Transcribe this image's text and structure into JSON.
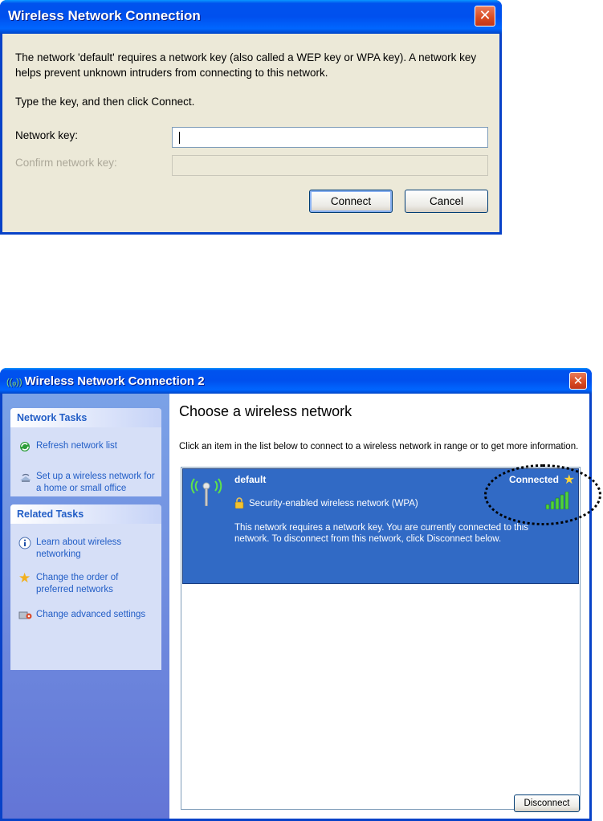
{
  "dialog": {
    "title": "Wireless Network Connection",
    "close_glyph": "✕",
    "message": "The network 'default' requires a network key (also called a WEP key or WPA key). A network key helps prevent unknown intruders from connecting to this network.",
    "prompt": "Type the key, and then click Connect.",
    "network_key_label": "Network key:",
    "confirm_key_label": "Confirm network key:",
    "network_key_value": "",
    "confirm_key_value": "",
    "connect_label": "Connect",
    "cancel_label": "Cancel"
  },
  "window": {
    "title": "Wireless Network Connection 2",
    "close_glyph": "✕",
    "network_tasks": {
      "heading": "Network Tasks",
      "items": [
        {
          "label": "Refresh network list",
          "icon": "refresh-icon"
        },
        {
          "label": "Set up a wireless network for a home or small office",
          "icon": "setup-wireless-icon"
        }
      ]
    },
    "related_tasks": {
      "heading": "Related Tasks",
      "items": [
        {
          "label": "Learn about wireless networking",
          "icon": "info-icon"
        },
        {
          "label": "Change the order of preferred networks",
          "icon": "star-icon"
        },
        {
          "label": "Change advanced settings",
          "icon": "settings-icon"
        }
      ]
    },
    "content": {
      "title": "Choose a wireless network",
      "description": "Click an item in the list below to connect to a wireless network in range or to get more information.",
      "network": {
        "name": "default",
        "status": "Connected",
        "security": "Security-enabled wireless network (WPA)",
        "note": "This network requires a network key. You are currently connected to this network. To disconnect from this network, click Disconnect below.",
        "signal_bars": 5,
        "signal_max": 5
      },
      "disconnect_label": "Disconnect"
    },
    "colors": {
      "titlebar": "#0054e3",
      "taskpane": "#6375d6",
      "selection": "#316ac5",
      "task_link": "#215dc6"
    }
  }
}
